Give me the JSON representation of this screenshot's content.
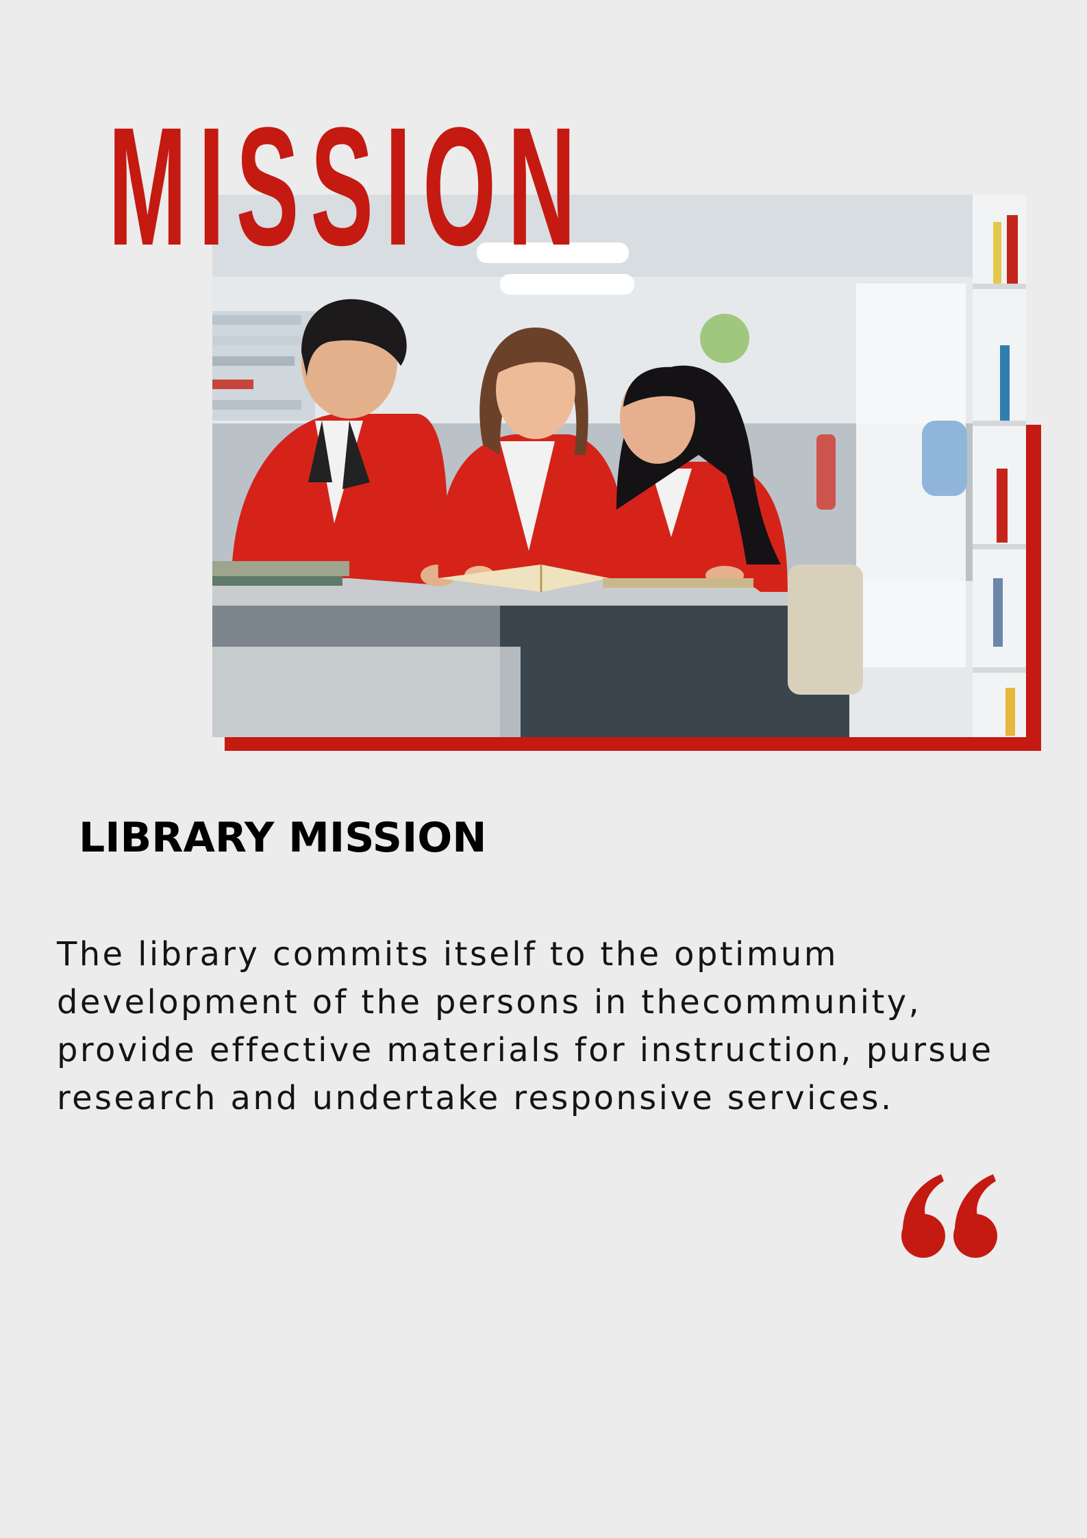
{
  "page": {
    "title": "MISSION",
    "section_heading": "LIBRARY MISSION",
    "mission_text": "The library commits itself to the optimum development of the persons in thecommunity, provide effective materials for instruction, pursue research and undertake responsive services."
  },
  "icons": {
    "photo": "students-reading-in-library-photo",
    "quote": "opening-quote-icon"
  },
  "colors": {
    "accent": "#c41a11",
    "background": "#ececec",
    "text": "#141414"
  }
}
